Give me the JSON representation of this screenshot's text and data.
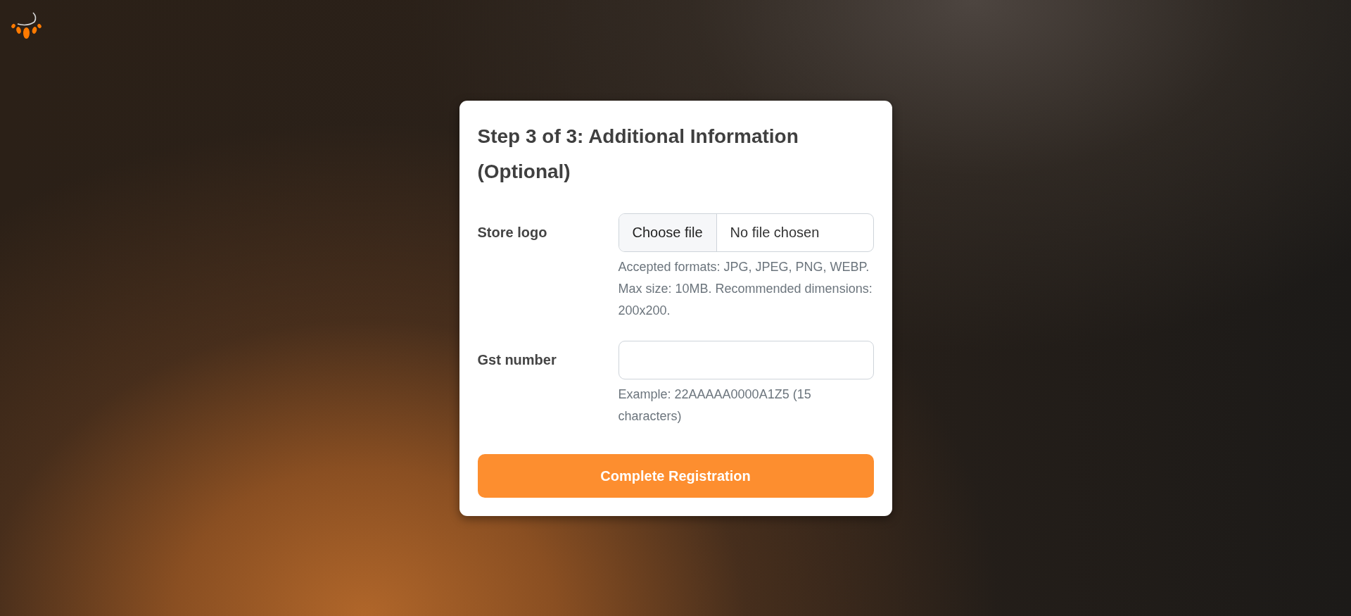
{
  "card": {
    "title": "Step 3 of 3: Additional Information (Optional)",
    "fields": [
      {
        "kind": "file",
        "label": "Store logo",
        "button": "Choose file",
        "status": "No file chosen",
        "help": "Accepted formats: JPG, JPEG, PNG, WEBP. Max size: 10MB. Recommended dimensions: 200x200."
      },
      {
        "kind": "text",
        "label": "Gst number",
        "help": "Example: 22AAAAA0000A1Z5 (15 characters)"
      }
    ],
    "submit": "Complete Registration"
  }
}
